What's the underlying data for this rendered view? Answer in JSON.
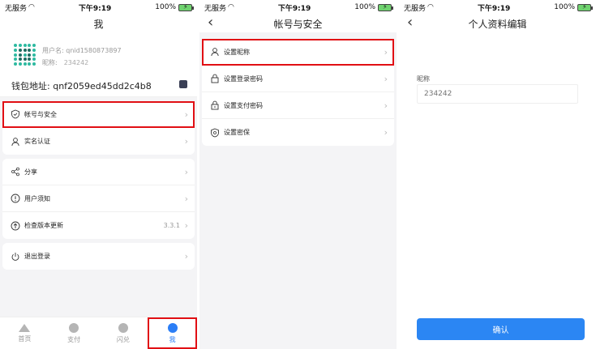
{
  "status": {
    "carrier": "无服务",
    "time": "下午9:19",
    "battery": "100%"
  },
  "screen1": {
    "title": "我",
    "username_label": "用户名:",
    "username": "qnid1580873897",
    "nickname_label": "昵称:",
    "nickname": "234242",
    "wallet_label": "钱包地址:",
    "wallet_address": "qnf2059ed45dd2c4b8",
    "group1": [
      {
        "label": "帐号与安全",
        "icon": "shield-icon"
      },
      {
        "label": "实名认证",
        "icon": "user-icon"
      }
    ],
    "group2": [
      {
        "label": "分享",
        "icon": "share-icon"
      },
      {
        "label": "用户须知",
        "icon": "info-icon"
      },
      {
        "label": "检查版本更新",
        "icon": "update-icon",
        "extra": "3.3.1"
      }
    ],
    "group3": [
      {
        "label": "退出登录",
        "icon": "power-icon"
      }
    ],
    "tabs": [
      {
        "label": "首页",
        "icon": "home-icon"
      },
      {
        "label": "支付",
        "icon": "pay-icon"
      },
      {
        "label": "闪兑",
        "icon": "exchange-icon"
      },
      {
        "label": "我",
        "icon": "profile-icon",
        "active": true
      }
    ]
  },
  "screen2": {
    "title": "帐号与安全",
    "items": [
      {
        "label": "设置昵称",
        "icon": "user-icon"
      },
      {
        "label": "设置登录密码",
        "icon": "lock-icon"
      },
      {
        "label": "设置支付密码",
        "icon": "lock-icon"
      },
      {
        "label": "设置密保",
        "icon": "shield-icon"
      }
    ]
  },
  "screen3": {
    "title": "个人资料编辑",
    "field_label": "昵称",
    "field_placeholder": "234242",
    "confirm_label": "确认"
  },
  "colors": {
    "highlight": "#e10f14",
    "accent": "#2b86f3"
  }
}
